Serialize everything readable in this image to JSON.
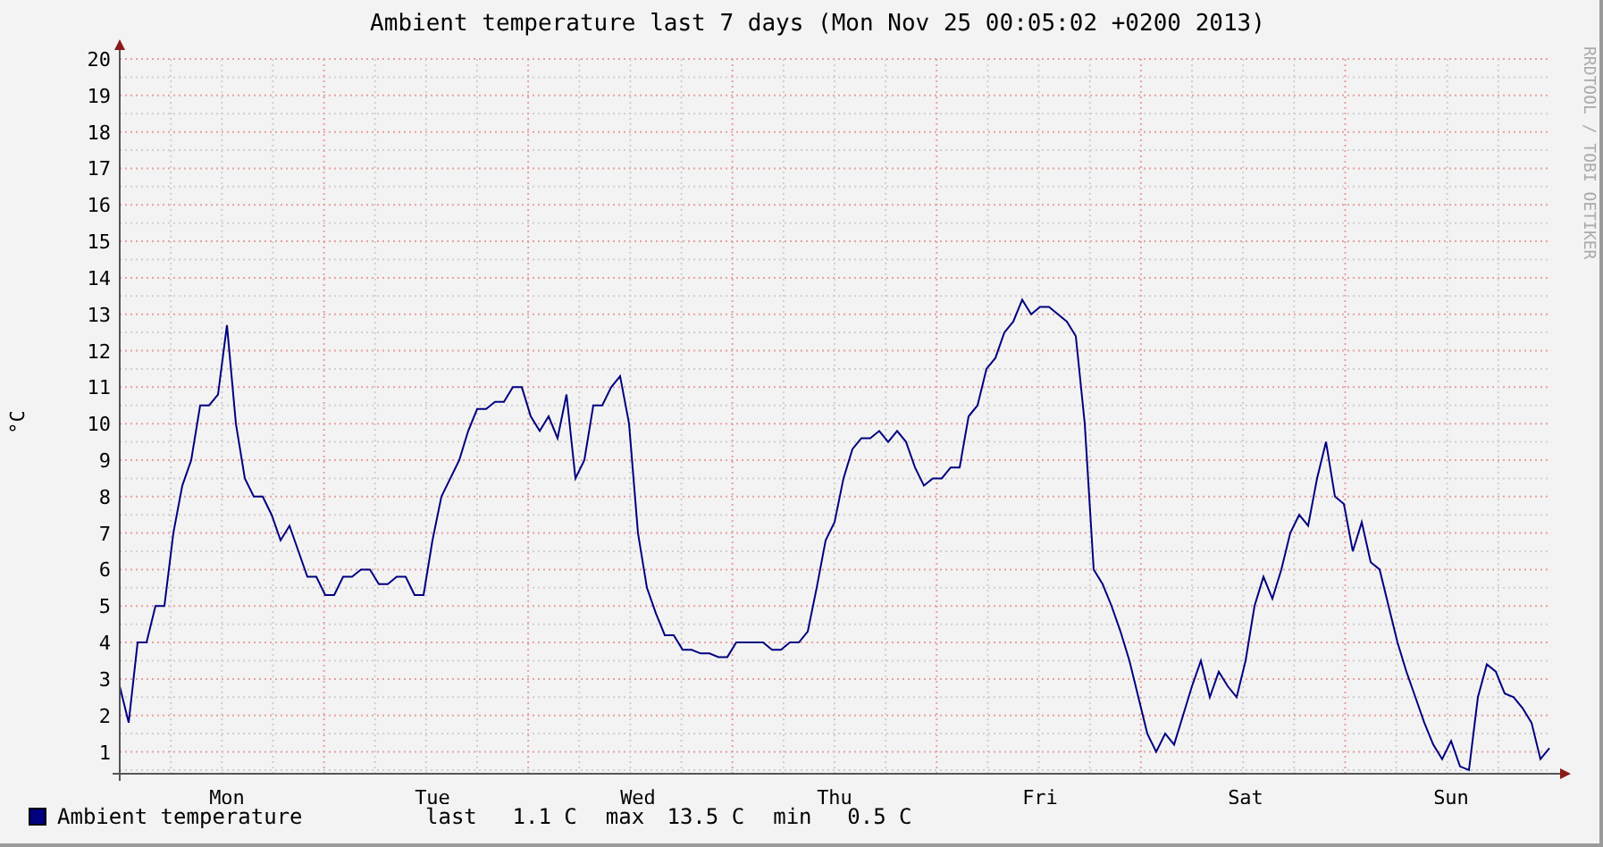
{
  "title": "Ambient temperature last 7 days (Mon Nov 25 00:05:02 +0200 2013)",
  "side_text": "RRDTOOL / TOBI OETIKER",
  "chart_data": {
    "type": "line",
    "grid": true,
    "ylabel": "°C",
    "ylim": [
      0.4,
      20
    ],
    "yticks": [
      1,
      2,
      3,
      4,
      5,
      6,
      7,
      8,
      9,
      10,
      11,
      12,
      13,
      14,
      15,
      16,
      17,
      18,
      19,
      20
    ],
    "categories": [
      null,
      null,
      null,
      null,
      null,
      null,
      null,
      null,
      null,
      null,
      null,
      null,
      "Mon",
      null,
      null,
      null,
      null,
      null,
      null,
      null,
      null,
      null,
      null,
      null,
      null,
      null,
      null,
      null,
      null,
      null,
      null,
      null,
      null,
      null,
      null,
      "Tue",
      null,
      null,
      null,
      null,
      null,
      null,
      null,
      null,
      null,
      null,
      null,
      null,
      null,
      null,
      null,
      null,
      null,
      null,
      null,
      null,
      null,
      null,
      "Wed",
      null,
      null,
      null,
      null,
      null,
      null,
      null,
      null,
      null,
      null,
      null,
      null,
      null,
      null,
      null,
      null,
      null,
      null,
      null,
      null,
      null,
      "Thu",
      null,
      null,
      null,
      null,
      null,
      null,
      null,
      null,
      null,
      null,
      null,
      null,
      null,
      null,
      null,
      null,
      null,
      null,
      null,
      null,
      null,
      null,
      "Fri",
      null,
      null,
      null,
      null,
      null,
      null,
      null,
      null,
      null,
      null,
      null,
      null,
      null,
      null,
      null,
      null,
      null,
      null,
      null,
      null,
      null,
      null,
      "Sat",
      null,
      null,
      null,
      null,
      null,
      null,
      null,
      null,
      null,
      null,
      null,
      null,
      null,
      null,
      null,
      null,
      null,
      null,
      null,
      null,
      null,
      null,
      "Sun",
      null,
      null,
      null,
      null,
      null,
      null,
      null,
      null,
      null,
      null,
      null
    ],
    "series": [
      {
        "name": "Ambient temperature",
        "color": "#000080",
        "values": [
          2.8,
          1.8,
          4,
          4,
          5,
          5,
          7,
          8.3,
          9,
          10.5,
          10.5,
          10.8,
          12.7,
          10,
          8.5,
          8,
          8,
          7.5,
          6.8,
          7.2,
          6.5,
          5.8,
          5.8,
          5.3,
          5.3,
          5.8,
          5.8,
          6,
          6,
          5.6,
          5.6,
          5.8,
          5.8,
          5.3,
          5.3,
          6.8,
          8,
          8.5,
          9,
          9.8,
          10.4,
          10.4,
          10.6,
          10.6,
          11,
          11,
          10.2,
          9.8,
          10.2,
          9.6,
          10.8,
          8.5,
          9,
          10.5,
          10.5,
          11,
          11.3,
          10,
          7,
          5.5,
          4.8,
          4.2,
          4.2,
          3.8,
          3.8,
          3.7,
          3.7,
          3.6,
          3.6,
          4,
          4,
          4,
          4,
          3.8,
          3.8,
          4,
          4,
          4.3,
          5.5,
          6.8,
          7.3,
          8.5,
          9.3,
          9.6,
          9.6,
          9.8,
          9.5,
          9.8,
          9.5,
          8.8,
          8.3,
          8.5,
          8.5,
          8.8,
          8.8,
          10.2,
          10.5,
          11.5,
          11.8,
          12.5,
          12.8,
          13.4,
          13,
          13.2,
          13.2,
          13,
          12.8,
          12.4,
          10,
          6,
          5.6,
          5,
          4.3,
          3.5,
          2.5,
          1.5,
          1,
          1.5,
          1.2,
          2,
          2.8,
          3.5,
          2.5,
          3.2,
          2.8,
          2.5,
          3.5,
          5,
          5.8,
          5.2,
          6,
          7,
          7.5,
          7.2,
          8.5,
          9.5,
          8,
          7.8,
          6.5,
          7.3,
          6.2,
          6,
          5,
          4,
          3.2,
          2.5,
          1.8,
          1.2,
          0.8,
          1.3,
          0.6,
          0.5,
          2.5,
          3.4,
          3.2,
          2.6,
          2.5,
          2.2,
          1.8,
          0.8,
          1.1
        ]
      }
    ]
  },
  "legend": {
    "stats": [
      {
        "label": "last",
        "value": "1.1 C"
      },
      {
        "label": "max",
        "value": "13.5 C"
      },
      {
        "label": "min",
        "value": "0.5 C"
      }
    ]
  }
}
